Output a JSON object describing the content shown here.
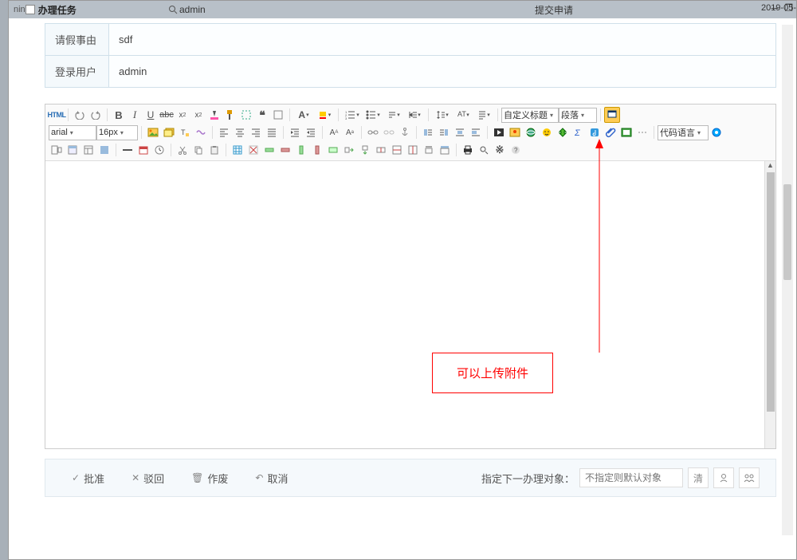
{
  "titlebar": {
    "left_prefix": "nin",
    "title": "办理任务",
    "search_user": "admin",
    "submit_label": "提交申请",
    "date_frag": "2019-05-"
  },
  "form": {
    "rows": [
      {
        "label": "请假事由",
        "value": "sdf"
      },
      {
        "label": "登录用户",
        "value": "admin"
      }
    ]
  },
  "editor": {
    "dropdowns": {
      "custom_title": "自定义标题",
      "paragraph": "段落",
      "font": "arial",
      "size": "16px",
      "code_lang": "代码语言"
    }
  },
  "annotation": {
    "text": "可以上传附件"
  },
  "footer": {
    "approve": "批准",
    "reject": "驳回",
    "void": "作废",
    "cancel": "取消",
    "assignee_label": "指定下一办理对象：",
    "assignee_placeholder": "不指定则默认对象",
    "clear": "清"
  }
}
